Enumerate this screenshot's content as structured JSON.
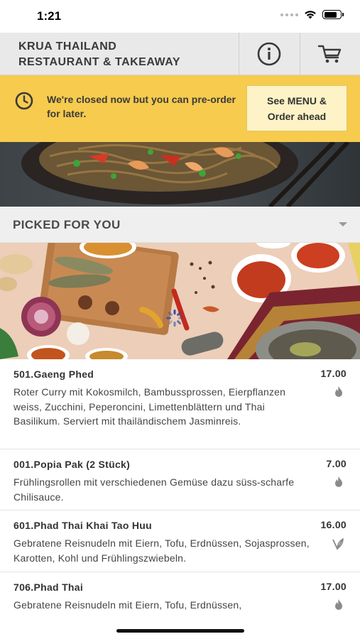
{
  "status_bar": {
    "time": "1:21",
    "icons": [
      "signal-dots-icon",
      "wifi-icon",
      "battery-icon"
    ]
  },
  "header": {
    "title_line1": "KRUA THAILAND",
    "title_line2": "RESTAURANT & TAKEAWAY",
    "buttons": [
      "info-icon",
      "cart-icon"
    ]
  },
  "notice": {
    "icon": "clock-icon",
    "text": "We're closed now but you can pre-order for later.",
    "button_line1": "See MENU &",
    "button_line2": "Order ahead"
  },
  "section": {
    "title": "PICKED FOR YOU"
  },
  "menu_items": [
    {
      "name": "501.Gaeng Phed",
      "price": "17.00",
      "description": "Roter Curry mit Kokosmilch, Bambussprossen, Eierpflanzen weiss, Zucchini, Peperoncini, Limettenblättern und Thai Basilikum. Serviert mit thailändischem Jasminreis.",
      "icon": "chili-flame-icon"
    },
    {
      "name": "001.Popia Pak (2 Stück)",
      "price": "7.00",
      "description": "Frühlingsrollen mit verschiedenen Gemüse dazu süss-scharfe Chilisauce.",
      "icon": "chili-flame-icon"
    },
    {
      "name": "601.Phad Thai Khai Tao Huu",
      "price": "16.00",
      "description": "Gebratene Reisnudeln mit Eiern, Tofu, Erdnüssen, Sojasprossen, Karotten, Kohl und Frühlingszwiebeln.",
      "icon": "vegetarian-leaf-icon"
    },
    {
      "name": "706.Phad Thai",
      "price": "17.00",
      "description": "Gebratene Reisnudeln mit Eiern, Tofu, Erdnüssen,",
      "icon": "chili-flame-icon"
    }
  ],
  "colors": {
    "notice_bg": "#f6cb4e",
    "order_button_bg": "#fdf3c6",
    "header_bg": "#e9e9e9",
    "section_bg": "#efefef"
  }
}
